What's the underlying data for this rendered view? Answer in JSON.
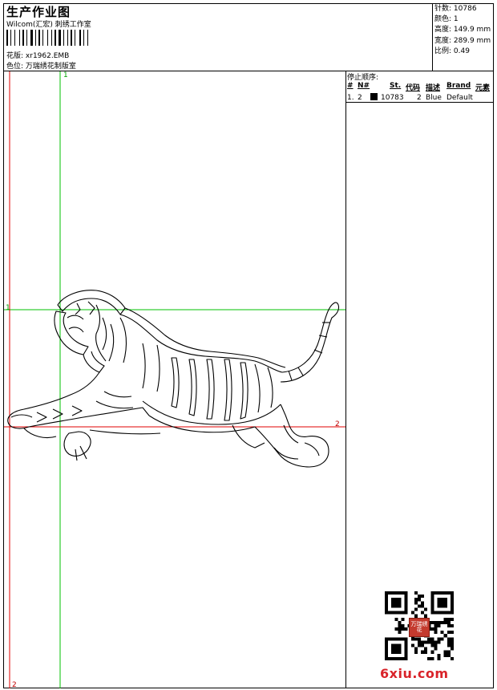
{
  "header": {
    "title": "生产作业图",
    "company": "Wilcom(汇宏) 刺绣工作室",
    "design_label": "花版:",
    "design_value": "xr1962.EMB",
    "color_label": "色位:",
    "color_value": "万瑞绣花制版室"
  },
  "stats": {
    "stitches_label": "针数:",
    "stitches_value": "10786",
    "colors_label": "颜色:",
    "colors_value": "1",
    "height_label": "高度:",
    "height_value": "149.9 mm",
    "width_label": "宽度:",
    "width_value": "289.9 mm",
    "scale_label": "比例:",
    "scale_value": "0.49"
  },
  "stop_sequence": {
    "title": "停止顺序:",
    "columns": [
      "#",
      "N#",
      "St.",
      "代码",
      "描述",
      "Brand",
      "元素"
    ],
    "rows": [
      {
        "index": "1.",
        "needle": "2",
        "stitches": "10783",
        "code": "2",
        "description": "Blue",
        "brand": "Default",
        "element": ""
      }
    ]
  },
  "markers": {
    "green_top": "1",
    "green_left": "1",
    "red_right": "2",
    "red_bottom": "2"
  },
  "colors": {
    "guide_green": "#00c000",
    "guide_red": "#e00000",
    "thread_swatch": "#000000"
  },
  "watermark": "6xiu.com",
  "seal_text": "万瑞绣花"
}
